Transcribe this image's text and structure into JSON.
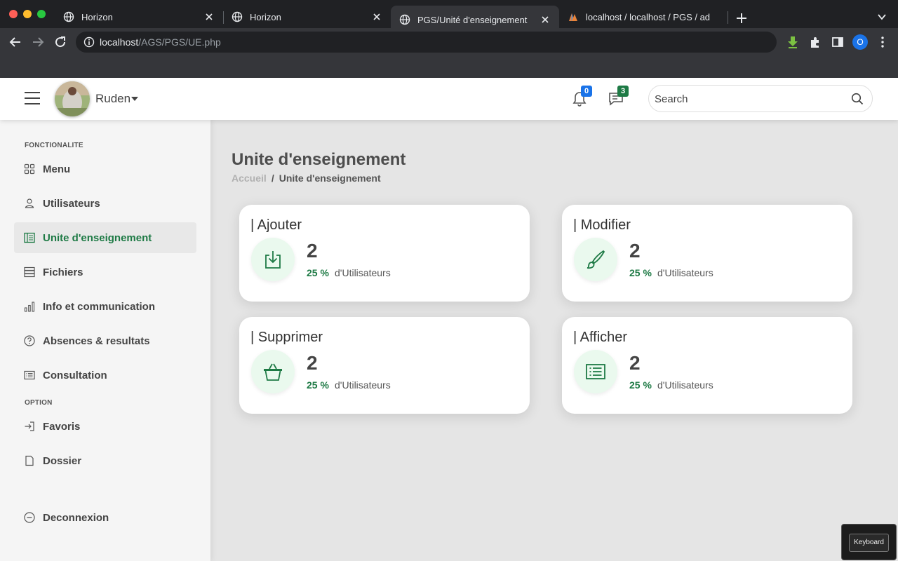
{
  "browser": {
    "tabs": [
      {
        "title": "Horizon",
        "active": false
      },
      {
        "title": "Horizon",
        "active": false
      },
      {
        "title": "PGS/Unité d'enseignement",
        "active": true
      },
      {
        "title": "localhost / localhost / PGS / ad",
        "active": false
      }
    ],
    "url_host": "localhost",
    "url_path": "/AGS/PGS/UE.php",
    "profile_initial": "O"
  },
  "header": {
    "user_name": "Ruden",
    "notification_count": "0",
    "message_count": "3",
    "search_placeholder": "Search"
  },
  "sidebar": {
    "section_main": "FONCTIONALITE",
    "section_option": "OPTION",
    "items": [
      {
        "label": "Menu",
        "icon": "grid-icon"
      },
      {
        "label": "Utilisateurs",
        "icon": "user-icon"
      },
      {
        "label": "Unite d'enseignement",
        "icon": "layout-icon",
        "active": true
      },
      {
        "label": "Fichiers",
        "icon": "files-icon"
      },
      {
        "label": "Info et communication",
        "icon": "bar-chart-icon"
      },
      {
        "label": "Absences & resultats",
        "icon": "question-circle-icon"
      },
      {
        "label": "Consultation",
        "icon": "list-icon"
      }
    ],
    "option_items": [
      {
        "label": "Favoris",
        "icon": "sign-in-icon"
      },
      {
        "label": "Dossier",
        "icon": "file-icon"
      }
    ],
    "logout_label": "Deconnexion"
  },
  "main": {
    "title": "Unite d'enseignement",
    "breadcrumb_home": "Accueil",
    "breadcrumb_separator": "/",
    "breadcrumb_current": "Unite d'enseignement",
    "cards": [
      {
        "title": "| Ajouter",
        "value": "2",
        "percent": "25 %",
        "unit": "d'Utilisateurs",
        "icon": "download-icon"
      },
      {
        "title": "| Modifier",
        "value": "2",
        "percent": "25 %",
        "unit": "d'Utilisateurs",
        "icon": "brush-icon"
      },
      {
        "title": "| Supprimer",
        "value": "2",
        "percent": "25 %",
        "unit": "d'Utilisateurs",
        "icon": "basket-icon"
      },
      {
        "title": "| Afficher",
        "value": "2",
        "percent": "25 %",
        "unit": "d'Utilisateurs",
        "icon": "list-icon"
      }
    ]
  },
  "keyboard_widget": {
    "label": "Keyboard"
  },
  "colors": {
    "accent": "#1e7a45",
    "notification_badge": "#1a73e8",
    "message_badge": "#1e7a45"
  }
}
